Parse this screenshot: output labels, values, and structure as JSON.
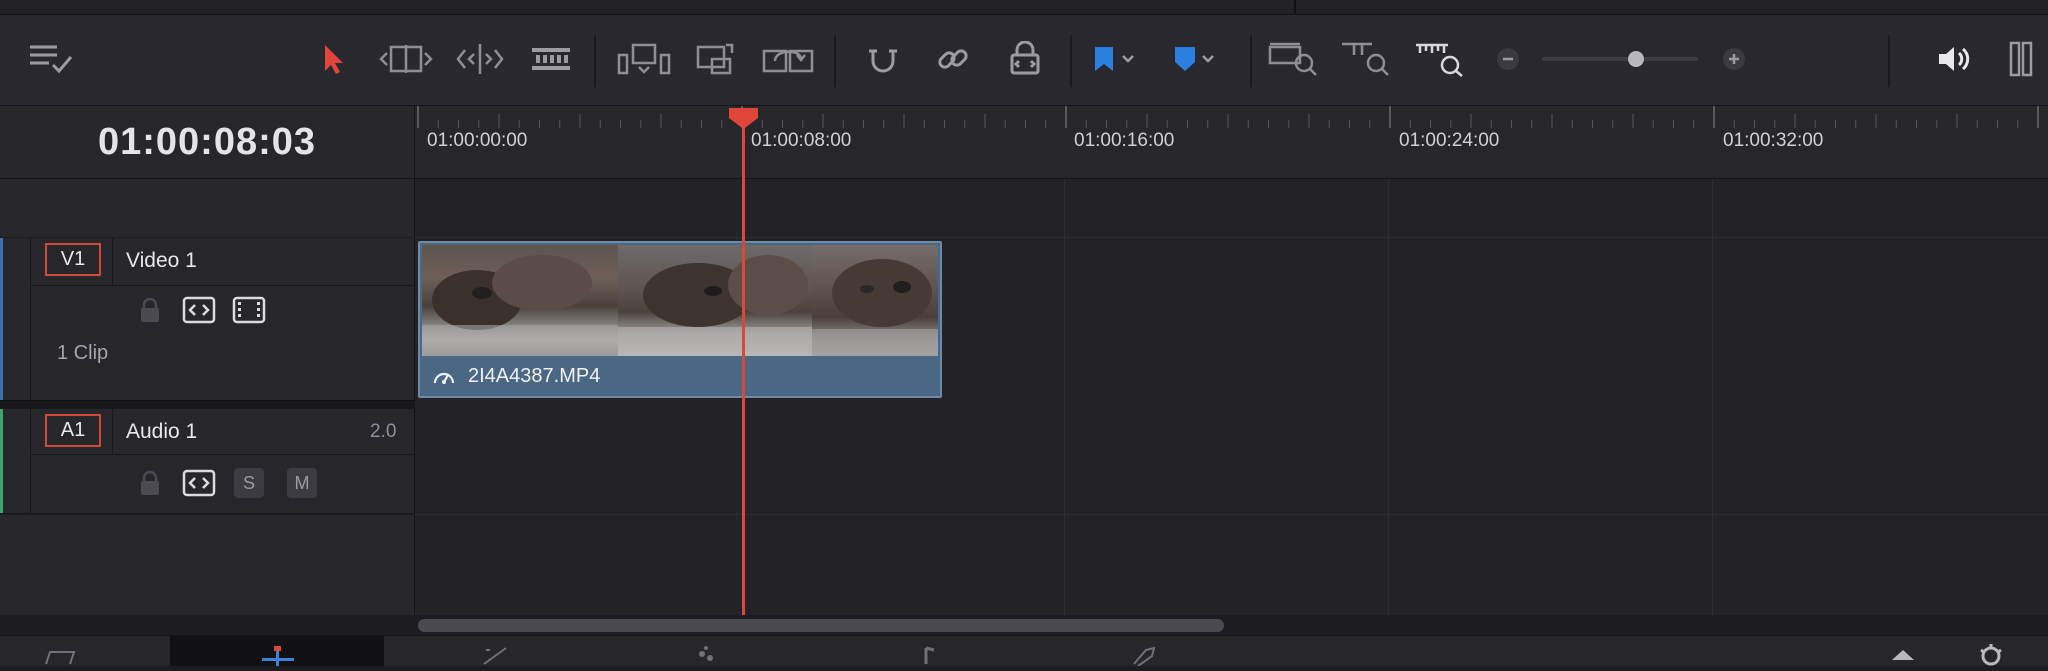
{
  "toolbar": {
    "tools": [
      {
        "name": "timeline-options-icon"
      },
      {
        "name": "selection-mode-icon",
        "color": "#e0453a"
      },
      {
        "name": "trim-edit-mode-icon"
      },
      {
        "name": "dynamic-trim-mode-icon"
      },
      {
        "name": "blade-edit-mode-icon"
      },
      {
        "name": "insert-clip-icon"
      },
      {
        "name": "overwrite-clip-icon"
      },
      {
        "name": "replace-clip-icon"
      },
      {
        "name": "snapping-icon"
      },
      {
        "name": "linked-selection-icon"
      },
      {
        "name": "position-lock-icon"
      },
      {
        "name": "flag-icon",
        "color": "#2a7fe0"
      },
      {
        "name": "marker-icon",
        "color": "#2a7fe0"
      },
      {
        "name": "full-extent-zoom-icon"
      },
      {
        "name": "detail-zoom-icon"
      },
      {
        "name": "custom-zoom-icon"
      },
      {
        "name": "zoom-out-icon"
      },
      {
        "name": "zoom-slider"
      },
      {
        "name": "zoom-in-icon"
      },
      {
        "name": "audio-volume-icon"
      }
    ],
    "zoom_level": 0.6
  },
  "timecode": "01:00:08:03",
  "ruler": {
    "labels": [
      "01:00:00:00",
      "01:00:08:00",
      "01:00:16:00",
      "01:00:24:00",
      "01:00:32:00"
    ]
  },
  "tracks": {
    "video": {
      "tag": "V1",
      "name": "Video 1",
      "clip_count": "1 Clip"
    },
    "audio": {
      "tag": "A1",
      "name": "Audio 1",
      "channels": "2.0",
      "solo_label": "S",
      "mute_label": "M"
    }
  },
  "clip": {
    "name": "2I4A4387.MP4",
    "color": "#4a6784"
  },
  "playhead": {
    "color": "#e0453a"
  },
  "colors": {
    "accent_red": "#e0453a",
    "video_track_stripe": "#3f6fb0",
    "audio_track_stripe": "#3aa56a"
  }
}
